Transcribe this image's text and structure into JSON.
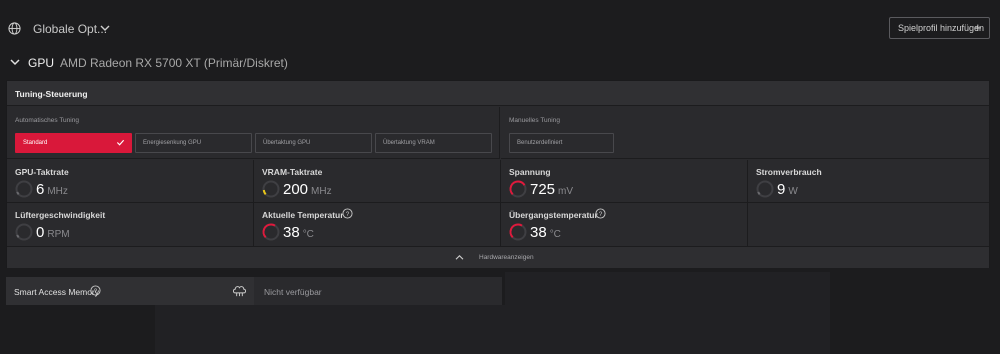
{
  "header": {
    "title": "Globale Opt...",
    "profile_button": "Spielprofil hinzufügen",
    "plus": "+"
  },
  "gpu": {
    "label": "GPU",
    "name": "AMD Radeon RX 5700 XT (Primär/Diskret)"
  },
  "tuning": {
    "title": "Tuning-Steuerung",
    "auto_label": "Automatisches Tuning",
    "manual_label": "Manuelles Tuning",
    "auto_options": [
      "Standard",
      "Energiesenkung GPU",
      "Übertaktung GPU",
      "Übertaktung VRAM"
    ],
    "selected": "Standard",
    "manual_options": [
      "Benutzerdefiniert"
    ]
  },
  "metrics": [
    {
      "label": "GPU-Taktrate",
      "value": "6",
      "unit": "MHz",
      "gauge_color": "#6a6a6e"
    },
    {
      "label": "VRAM-Taktrate",
      "value": "200",
      "unit": "MHz",
      "gauge_color": "#e6c419"
    },
    {
      "label": "Spannung",
      "value": "725",
      "unit": "mV",
      "gauge_color": "#e0193c"
    },
    {
      "label": "Stromverbrauch",
      "value": "9",
      "unit": "W",
      "gauge_color": "#6a6a6e"
    },
    {
      "label": "Lüftergeschwindigkeit",
      "value": "0",
      "unit": "RPM",
      "gauge_color": "#6a6a6e"
    },
    {
      "label": "Aktuelle Temperatur",
      "value": "38",
      "unit": "°C",
      "gauge_color": "#e0193c"
    },
    {
      "label": "Übergangstemperatur",
      "value": "38",
      "unit": "°C",
      "gauge_color": "#e0193c"
    }
  ],
  "hardware_toggle": "Hardwareanzeigen",
  "smart_access": {
    "label": "Smart Access Memory",
    "value": "Nicht verfügbar"
  },
  "colors": {
    "accent": "#d9183a",
    "background": "#1c1c1e",
    "panel": "#2a2a2d"
  }
}
